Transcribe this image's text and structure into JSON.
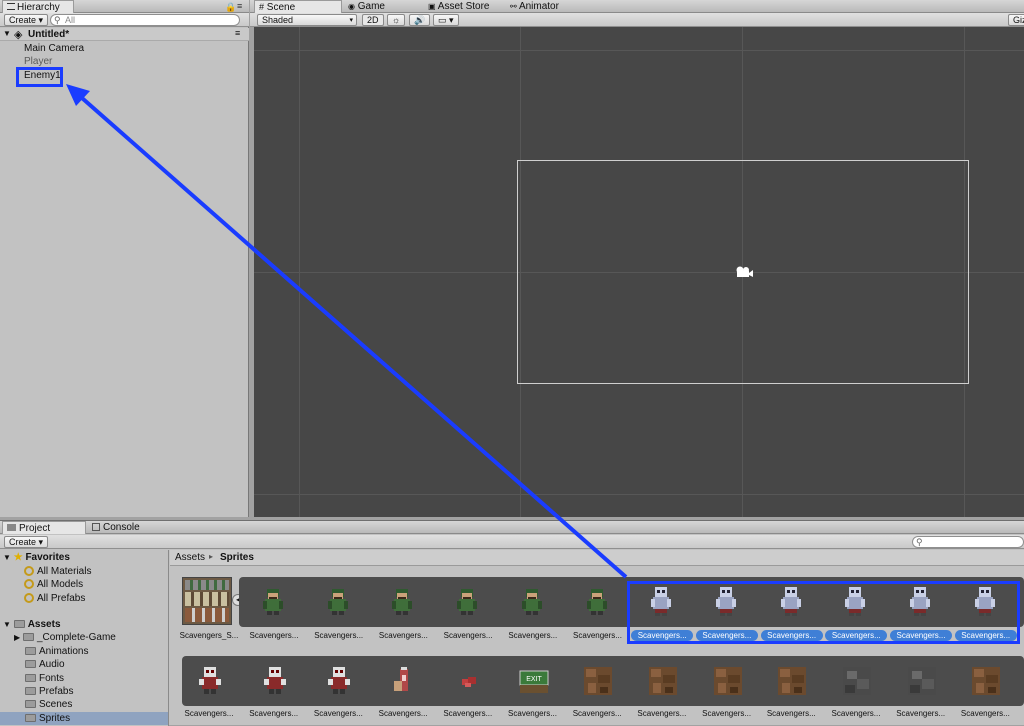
{
  "hierarchy": {
    "tab_label": "Hierarchy",
    "create_label": "Create",
    "search_placeholder": "All",
    "scene_name": "Untitled*",
    "items": [
      "Main Camera",
      "Player",
      "Enemy1"
    ]
  },
  "scene_tabs": {
    "scene": "Scene",
    "game": "Game",
    "asset_store": "Asset Store",
    "animator": "Animator"
  },
  "scene_toolbar": {
    "shading_mode": "Shaded",
    "mode_2d": "2D",
    "gizmos": "Giz"
  },
  "project": {
    "tab_project": "Project",
    "tab_console": "Console",
    "create_label": "Create",
    "breadcrumb_root": "Assets",
    "breadcrumb_current": "Sprites",
    "favorites_label": "Favorites",
    "favorites": [
      "All Materials",
      "All Models",
      "All Prefabs"
    ],
    "assets_label": "Assets",
    "folders": [
      "_Complete-Game",
      "Animations",
      "Audio",
      "Fonts",
      "Prefabs",
      "Scenes",
      "Sprites"
    ],
    "selected_folder": "Sprites",
    "row1_labels": [
      "Scavengers_S...",
      "Scavengers...",
      "Scavengers...",
      "Scavengers...",
      "Scavengers...",
      "Scavengers...",
      "Scavengers...",
      "Scavengers...",
      "Scavengers...",
      "Scavengers...",
      "Scavengers...",
      "Scavengers...",
      "Scavengers..."
    ],
    "row2_labels": [
      "Scavengers...",
      "Scavengers...",
      "Scavengers...",
      "Scavengers...",
      "Scavengers...",
      "Scavengers...",
      "Scavengers...",
      "Scavengers...",
      "Scavengers...",
      "Scavengers...",
      "Scavengers...",
      "Scavengers...",
      "Scavengers...",
      "Scavengers..."
    ]
  },
  "colors": {
    "highlight_blue": "#1a3cff",
    "selection_blue": "#3f7fd6"
  }
}
